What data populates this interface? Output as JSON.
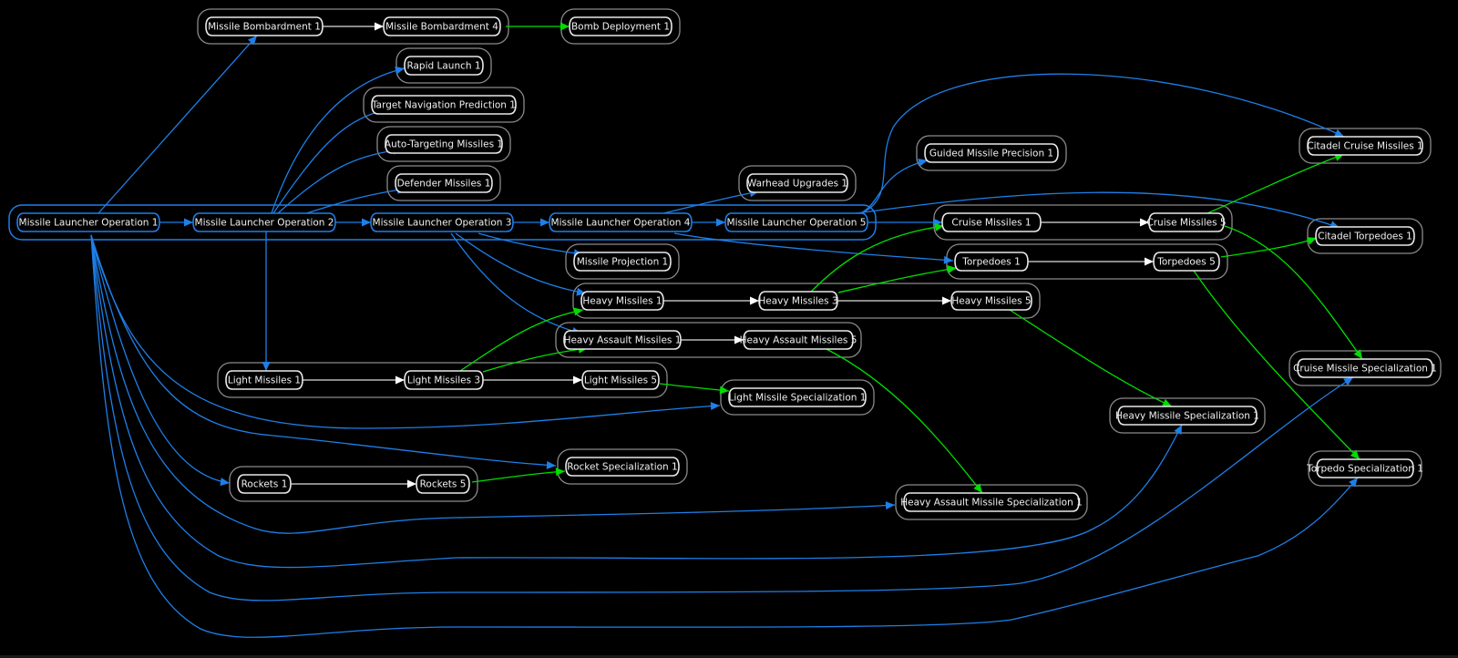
{
  "diagram": {
    "type": "skill-dependency-graph",
    "colors": {
      "background": "#000000",
      "prerequisite_edge": "#1e7fe8",
      "unlock_edge": "#00dd00",
      "chain_edge": "#dcdcdc",
      "node_border": "#e8e8e8",
      "cluster_border": "#8a8a8a",
      "root_cluster_border": "#1e7fe8"
    },
    "nodes": {
      "mlo1": "Missile Launcher Operation 1",
      "mlo2": "Missile Launcher Operation 2",
      "mlo3": "Missile Launcher Operation 3",
      "mlo4": "Missile Launcher Operation 4",
      "mlo5": "Missile Launcher Operation 5",
      "mb1": "Missile Bombardment 1",
      "mb4": "Missile Bombardment 4",
      "bd1": "Bomb Deployment 1",
      "rl1": "Rapid Launch 1",
      "tnp1": "Target Navigation Prediction 1",
      "atm1": "Auto-Targeting Missiles 1",
      "dm1": "Defender Missiles 1",
      "wu1": "Warhead Upgrades 1",
      "gmp1": "Guided Missile Precision 1",
      "mp1": "Missile Projection 1",
      "cm1": "Cruise Missiles 1",
      "cm5": "Cruise Missiles 5",
      "t1": "Torpedoes 1",
      "t5": "Torpedoes 5",
      "hm1": "Heavy Missiles 1",
      "hm3": "Heavy Missiles 3",
      "hm5": "Heavy Missiles 5",
      "ham1": "Heavy Assault Missiles 1",
      "ham5": "Heavy Assault Missiles 5",
      "lm1": "Light Missiles 1",
      "lm3": "Light Missiles 3",
      "lm5": "Light Missiles 5",
      "lms1": "Light Missile Specialization 1",
      "r1": "Rockets 1",
      "r5": "Rockets 5",
      "rs1": "Rocket Specialization 1",
      "hams1": "Heavy Assault Missile Specialization 1",
      "hms1": "Heavy Missile Specialization 1",
      "ccm1": "Citadel Cruise Missiles 1",
      "ct1": "Citadel Torpedoes 1",
      "cms1": "Cruise Missile Specialization 1",
      "ts1": "Torpedo Specialization 1"
    },
    "clusters": [
      [
        "mlo1",
        "mlo2",
        "mlo3",
        "mlo4",
        "mlo5"
      ],
      [
        "mb1",
        "mb4"
      ],
      [
        "bd1"
      ],
      [
        "rl1"
      ],
      [
        "tnp1"
      ],
      [
        "atm1"
      ],
      [
        "dm1"
      ],
      [
        "wu1"
      ],
      [
        "gmp1"
      ],
      [
        "mp1"
      ],
      [
        "cm1",
        "cm5"
      ],
      [
        "t1",
        "t5"
      ],
      [
        "hm1",
        "hm3",
        "hm5"
      ],
      [
        "ham1",
        "ham5"
      ],
      [
        "lm1",
        "lm3",
        "lm5"
      ],
      [
        "lms1"
      ],
      [
        "r1",
        "r5"
      ],
      [
        "rs1"
      ],
      [
        "hams1"
      ],
      [
        "hms1"
      ],
      [
        "ccm1"
      ],
      [
        "ct1"
      ],
      [
        "cms1"
      ],
      [
        "ts1"
      ]
    ],
    "edges": [
      {
        "from": "mlo1",
        "to": "mlo2",
        "kind": "prerequisite"
      },
      {
        "from": "mlo2",
        "to": "mlo3",
        "kind": "prerequisite"
      },
      {
        "from": "mlo3",
        "to": "mlo4",
        "kind": "prerequisite"
      },
      {
        "from": "mlo4",
        "to": "mlo5",
        "kind": "prerequisite"
      },
      {
        "from": "mlo1",
        "to": "mb1",
        "kind": "prerequisite"
      },
      {
        "from": "mb1",
        "to": "mb4",
        "kind": "chain"
      },
      {
        "from": "mb4",
        "to": "bd1",
        "kind": "unlock"
      },
      {
        "from": "mlo2",
        "to": "rl1",
        "kind": "prerequisite"
      },
      {
        "from": "mlo2",
        "to": "tnp1",
        "kind": "prerequisite"
      },
      {
        "from": "mlo2",
        "to": "atm1",
        "kind": "prerequisite"
      },
      {
        "from": "mlo2",
        "to": "dm1",
        "kind": "prerequisite"
      },
      {
        "from": "mlo2",
        "to": "lm1",
        "kind": "prerequisite"
      },
      {
        "from": "mlo3",
        "to": "mp1",
        "kind": "prerequisite"
      },
      {
        "from": "mlo3",
        "to": "hm1",
        "kind": "prerequisite"
      },
      {
        "from": "mlo3",
        "to": "ham1",
        "kind": "prerequisite"
      },
      {
        "from": "mlo4",
        "to": "wu1",
        "kind": "prerequisite"
      },
      {
        "from": "mlo4",
        "to": "t1",
        "kind": "prerequisite"
      },
      {
        "from": "mlo5",
        "to": "gmp1",
        "kind": "prerequisite"
      },
      {
        "from": "mlo5",
        "to": "cm1",
        "kind": "prerequisite"
      },
      {
        "from": "mlo5",
        "to": "ccm1",
        "kind": "prerequisite"
      },
      {
        "from": "mlo5",
        "to": "ct1",
        "kind": "prerequisite"
      },
      {
        "from": "cm1",
        "to": "cm5",
        "kind": "chain"
      },
      {
        "from": "t1",
        "to": "t5",
        "kind": "chain"
      },
      {
        "from": "hm1",
        "to": "hm3",
        "kind": "chain"
      },
      {
        "from": "hm3",
        "to": "hm5",
        "kind": "chain"
      },
      {
        "from": "ham1",
        "to": "ham5",
        "kind": "chain"
      },
      {
        "from": "lm1",
        "to": "lm3",
        "kind": "chain"
      },
      {
        "from": "lm3",
        "to": "lm5",
        "kind": "chain"
      },
      {
        "from": "r1",
        "to": "r5",
        "kind": "chain"
      },
      {
        "from": "hm3",
        "to": "cm1",
        "kind": "unlock"
      },
      {
        "from": "hm3",
        "to": "t1",
        "kind": "unlock"
      },
      {
        "from": "lm3",
        "to": "hm1",
        "kind": "unlock"
      },
      {
        "from": "lm3",
        "to": "ham1",
        "kind": "unlock"
      },
      {
        "from": "lm5",
        "to": "lms1",
        "kind": "unlock"
      },
      {
        "from": "r5",
        "to": "rs1",
        "kind": "unlock"
      },
      {
        "from": "ham5",
        "to": "hams1",
        "kind": "unlock"
      },
      {
        "from": "hm5",
        "to": "hms1",
        "kind": "unlock"
      },
      {
        "from": "cm5",
        "to": "ccm1",
        "kind": "unlock"
      },
      {
        "from": "cm5",
        "to": "cms1",
        "kind": "unlock"
      },
      {
        "from": "t5",
        "to": "ct1",
        "kind": "unlock"
      },
      {
        "from": "t5",
        "to": "ts1",
        "kind": "unlock"
      },
      {
        "from": "mlo1",
        "to": "r1",
        "kind": "prerequisite"
      },
      {
        "from": "mlo1",
        "to": "lms1",
        "kind": "prerequisite"
      },
      {
        "from": "mlo1",
        "to": "rs1",
        "kind": "prerequisite"
      },
      {
        "from": "mlo1",
        "to": "hams1",
        "kind": "prerequisite"
      },
      {
        "from": "mlo1",
        "to": "hms1",
        "kind": "prerequisite"
      },
      {
        "from": "mlo1",
        "to": "cms1",
        "kind": "prerequisite"
      },
      {
        "from": "mlo1",
        "to": "ts1",
        "kind": "prerequisite"
      }
    ]
  }
}
